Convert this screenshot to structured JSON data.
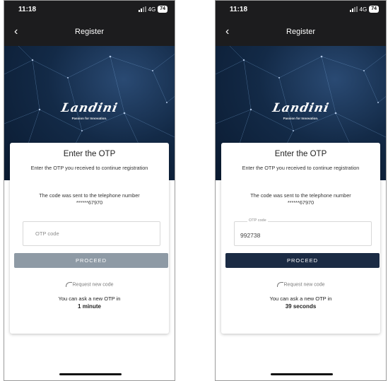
{
  "screens": [
    {
      "status": {
        "time": "11:18",
        "network": "4G",
        "battery": "74"
      },
      "nav": {
        "back": "‹",
        "title": "Register"
      },
      "brand": {
        "logo": "Landini",
        "tagline": "Passion for Innovation."
      },
      "card": {
        "title": "Enter the OTP",
        "instruction": "Enter the OTP you received to continue registration",
        "sent_text": "The code was sent to the telephone number",
        "phone_masked": "******67970",
        "otp_placeholder": "OTP code",
        "otp_label": "",
        "otp_value": "",
        "proceed_label": "PROCEED",
        "proceed_color": "#8e9aa5",
        "request_label": "Request new code",
        "timer_text": "You can ask a new OTP in",
        "timer_value": "1 minute"
      }
    },
    {
      "status": {
        "time": "11:18",
        "network": "4G",
        "battery": "74"
      },
      "nav": {
        "back": "‹",
        "title": "Register"
      },
      "brand": {
        "logo": "Landini",
        "tagline": "Passion for Innovation."
      },
      "card": {
        "title": "Enter the OTP",
        "instruction": "Enter the OTP you received to continue registration",
        "sent_text": "The code was sent to the telephone number",
        "phone_masked": "******67970",
        "otp_placeholder": "",
        "otp_label": "OTP code",
        "otp_value": "992738",
        "proceed_label": "PROCEED",
        "proceed_color": "#1b2b44",
        "request_label": "Request new code",
        "timer_text": "You can ask a new OTP in",
        "timer_value": "39 seconds"
      }
    }
  ]
}
